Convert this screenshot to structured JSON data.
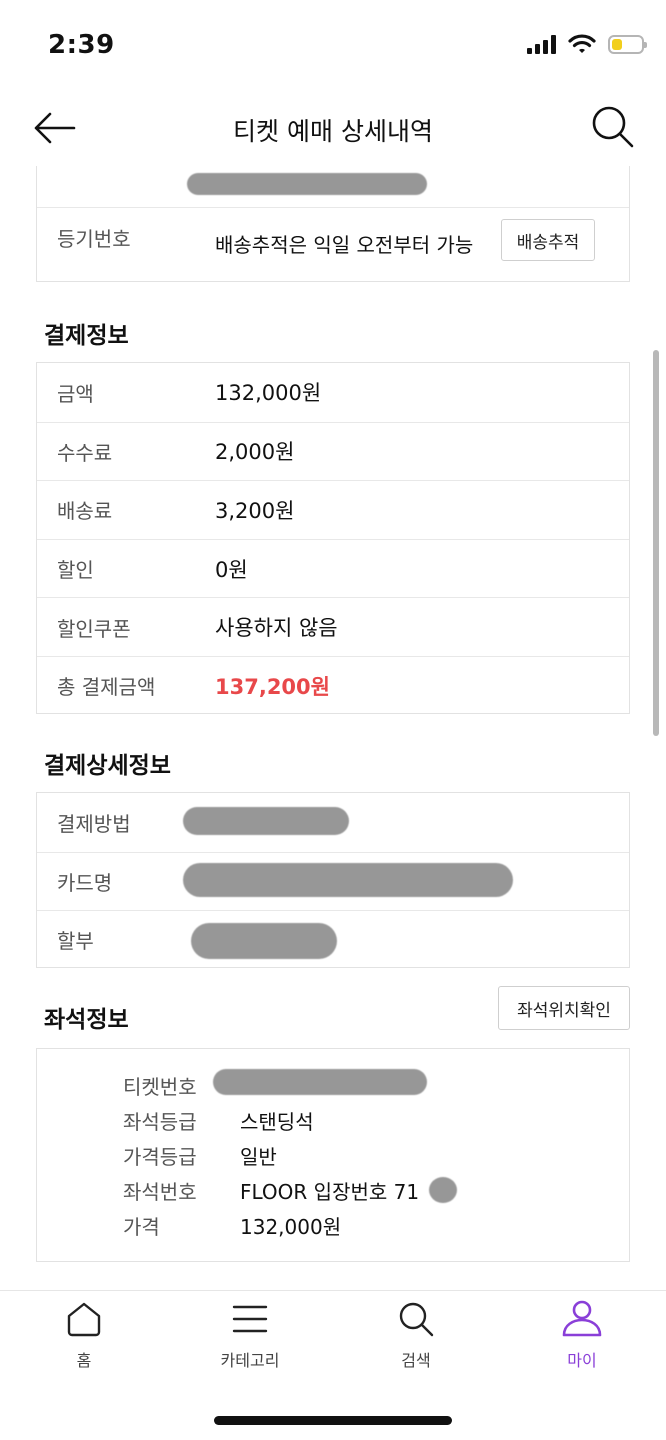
{
  "status_bar": {
    "time": "2:39",
    "battery_level": 0.35,
    "battery_color": "#f2cf1c"
  },
  "header": {
    "title": "티켓 예매 상세내역",
    "back_icon": "arrow-left-icon",
    "search_icon": "search-icon"
  },
  "delivery": {
    "label": "등기번호",
    "value": "배송추적은 익일 오전부터 가능",
    "button": "배송추적"
  },
  "payment": {
    "title": "결제정보",
    "rows": [
      {
        "label": "금액",
        "value": "132,000원"
      },
      {
        "label": "수수료",
        "value": "2,000원"
      },
      {
        "label": "배송료",
        "value": "3,200원"
      },
      {
        "label": "할인",
        "value": "0원"
      },
      {
        "label": "할인쿠폰",
        "value": "사용하지 않음"
      },
      {
        "label": "총 결제금액",
        "value": "137,200원"
      }
    ],
    "total_color": "#e8484a"
  },
  "payment_detail": {
    "title": "결제상세정보",
    "rows": [
      {
        "label": "결제방법"
      },
      {
        "label": "카드명"
      },
      {
        "label": "할부"
      }
    ]
  },
  "seat": {
    "title": "좌석정보",
    "button": "좌석위치확인",
    "rows": [
      {
        "label": "티켓번호",
        "value": ""
      },
      {
        "label": "좌석등급",
        "value": "스탠딩석"
      },
      {
        "label": "가격등급",
        "value": "일반"
      },
      {
        "label": "좌석번호",
        "value": "FLOOR 입장번호 71"
      },
      {
        "label": "가격",
        "value": "132,000원"
      }
    ]
  },
  "bottom_nav": {
    "items": [
      {
        "label": "홈",
        "icon": "home-icon"
      },
      {
        "label": "카테고리",
        "icon": "menu-icon"
      },
      {
        "label": "검색",
        "icon": "search-icon"
      },
      {
        "label": "마이",
        "icon": "user-icon"
      }
    ],
    "active_color": "#8a3fd8"
  }
}
